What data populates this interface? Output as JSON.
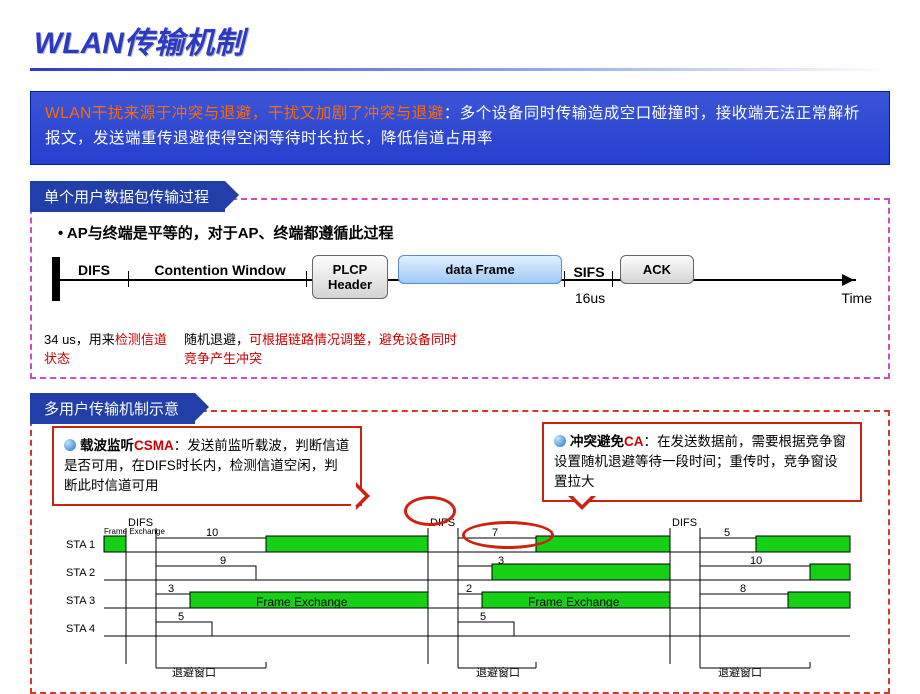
{
  "title": "WLAN传输机制",
  "blue": {
    "red": "WLAN干扰来源于冲突与退避，干扰又加剧了冲突与退避",
    "rest": "：多个设备同时传输造成空口碰撞时，接收端无法正常解析报文，发送端重传退避使得空闲等待时长拉长，降低信道占用率"
  },
  "section1": {
    "tab": "单个用户数据包传输过程",
    "subtitle": "• AP与终端是平等的，对于AP、终端都遵循此过程",
    "difs": "DIFS",
    "cw": "Contention Window",
    "plcp": "PLCP Header",
    "data": "data Frame",
    "sifs": "SIFS",
    "ack": "ACK",
    "timeLabel": "Time",
    "sifsVal": "16us",
    "note1a": "34 us，用来",
    "note1b": "检测信道状态",
    "note2a": "随机退避，",
    "note2b": "可根据链路情况调整，避免设备同时竞争产生冲突"
  },
  "section2": {
    "tab": "多用户传输机制示意",
    "csma": {
      "hdr_zh": "载波监听",
      "hdr_en": "CSMA",
      "body": "：发送前监听载波，判断信道是否可用，在DIFS时长内，检测信道空闲，判断此时信道可用"
    },
    "ca": {
      "hdr_zh": "冲突避免",
      "hdr_en": "CA",
      "body": "：在发送数据前，需要根据竞争窗设置随机退避等待一段时间；重传时，竞争窗设置拉大"
    }
  },
  "mu": {
    "difs": "DIFS",
    "sta": [
      "STA 1",
      "STA 2",
      "STA 3",
      "STA 4"
    ],
    "fe": "Frame Exchange",
    "backoff": "退避窗口",
    "vals": {
      "s1": [
        "10",
        "7",
        "5"
      ],
      "s2": [
        "9",
        "3",
        "10"
      ],
      "s3": [
        "3",
        "2",
        "8"
      ],
      "s4": [
        "5",
        "5"
      ]
    }
  }
}
